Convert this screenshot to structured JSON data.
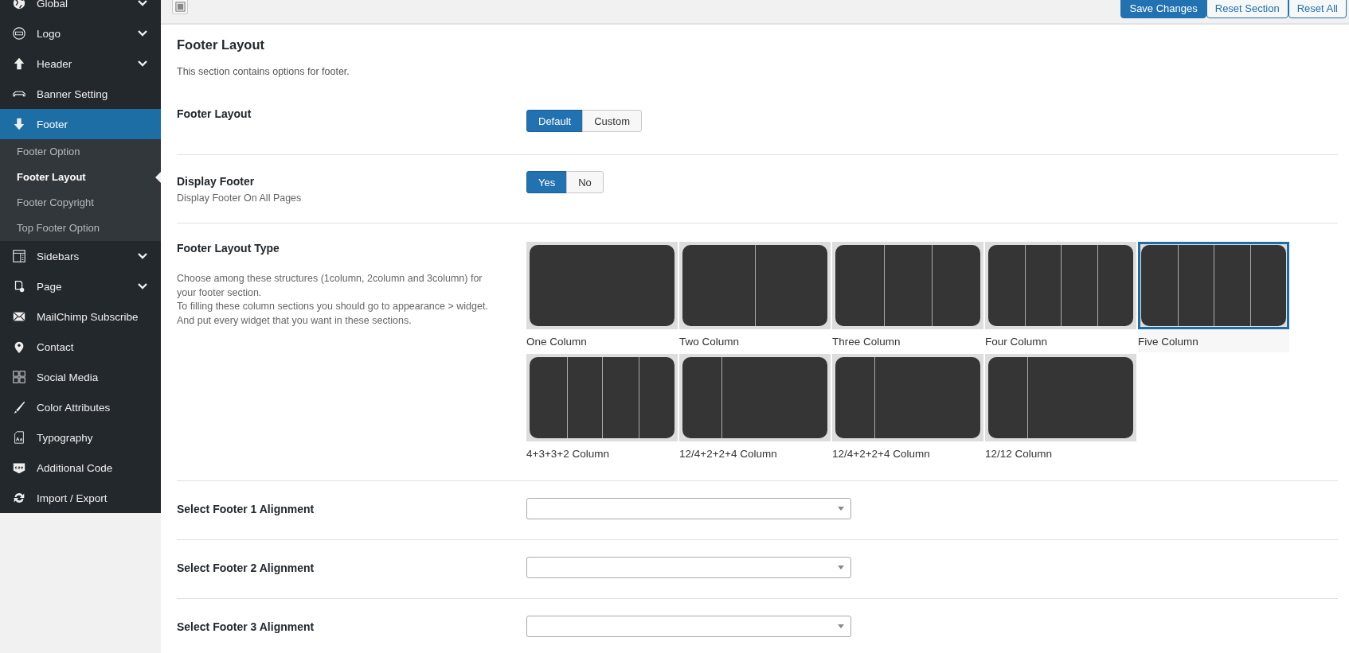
{
  "sidebar": {
    "items": [
      {
        "label": "Global",
        "collapsible": true,
        "selected": false
      },
      {
        "label": "Logo",
        "collapsible": true,
        "selected": false
      },
      {
        "label": "Header",
        "collapsible": true,
        "selected": false
      },
      {
        "label": "Banner Setting",
        "collapsible": false,
        "selected": false
      },
      {
        "label": "Footer",
        "collapsible": false,
        "selected": true,
        "children": [
          {
            "label": "Footer Option",
            "selected": false
          },
          {
            "label": "Footer Layout",
            "selected": true
          },
          {
            "label": "Footer Copyright",
            "selected": false
          },
          {
            "label": "Top Footer Option",
            "selected": false
          }
        ]
      },
      {
        "label": "Sidebars",
        "collapsible": true,
        "selected": false
      },
      {
        "label": "Page",
        "collapsible": true,
        "selected": false
      },
      {
        "label": "MailChimp Subscribe",
        "collapsible": false,
        "selected": false
      },
      {
        "label": "Contact",
        "collapsible": false,
        "selected": false
      },
      {
        "label": "Social Media",
        "collapsible": false,
        "selected": false
      },
      {
        "label": "Color Attributes",
        "collapsible": false,
        "selected": false
      },
      {
        "label": "Typography",
        "collapsible": false,
        "selected": false
      },
      {
        "label": "Additional Code",
        "collapsible": false,
        "selected": false
      },
      {
        "label": "Import / Export",
        "collapsible": false,
        "selected": false
      }
    ]
  },
  "toolbar": {
    "buttons": [
      {
        "label": "Save Changes",
        "kind": "primary"
      },
      {
        "label": "Reset Section",
        "kind": "secondary"
      },
      {
        "label": "Reset All",
        "kind": "secondary"
      }
    ]
  },
  "section": {
    "title": "Footer Layout",
    "description": "This section contains options for footer."
  },
  "fields": [
    {
      "kind": "buttonset",
      "label": "Footer Layout",
      "options": [
        {
          "label": "Default",
          "selected": true
        },
        {
          "label": "Custom",
          "selected": false
        }
      ]
    },
    {
      "kind": "buttonset",
      "label": "Display Footer",
      "subtitle": "Display Footer On All Pages",
      "options": [
        {
          "label": "Yes",
          "selected": true
        },
        {
          "label": "No",
          "selected": false
        }
      ]
    },
    {
      "kind": "image_select",
      "label": "Footer Layout Type",
      "description": [
        "Choose among these structures (1column, 2column and 3column) for your footer section.",
        "To filling these column sections you should go to appearance > widget.",
        "And put every widget that you want in these sections."
      ],
      "options": [
        {
          "label": "One Column",
          "kind": "one",
          "selected": false
        },
        {
          "label": "Two Column",
          "kind": "two",
          "selected": false
        },
        {
          "label": "Three Column",
          "kind": "three",
          "selected": false
        },
        {
          "label": "Four Column",
          "kind": "four",
          "selected": false
        },
        {
          "label": "Five Column",
          "kind": "five",
          "selected": true
        },
        {
          "label": "4+3+3+2 Column",
          "kind": "four-three-three-two",
          "selected": false
        },
        {
          "label": "12/4+2+2+4 Column",
          "kind": "wide-left",
          "selected": false
        },
        {
          "label": "12/4+2+2+4 Column",
          "kind": "wide-left",
          "selected": false
        },
        {
          "label": "12/12 Column",
          "kind": "wide-left",
          "selected": false
        }
      ]
    },
    {
      "kind": "select",
      "label": "Select Footer 1 Alignment"
    },
    {
      "kind": "select",
      "label": "Select Footer 2 Alignment"
    },
    {
      "kind": "select",
      "label": "Select Footer 3 Alignment"
    }
  ]
}
